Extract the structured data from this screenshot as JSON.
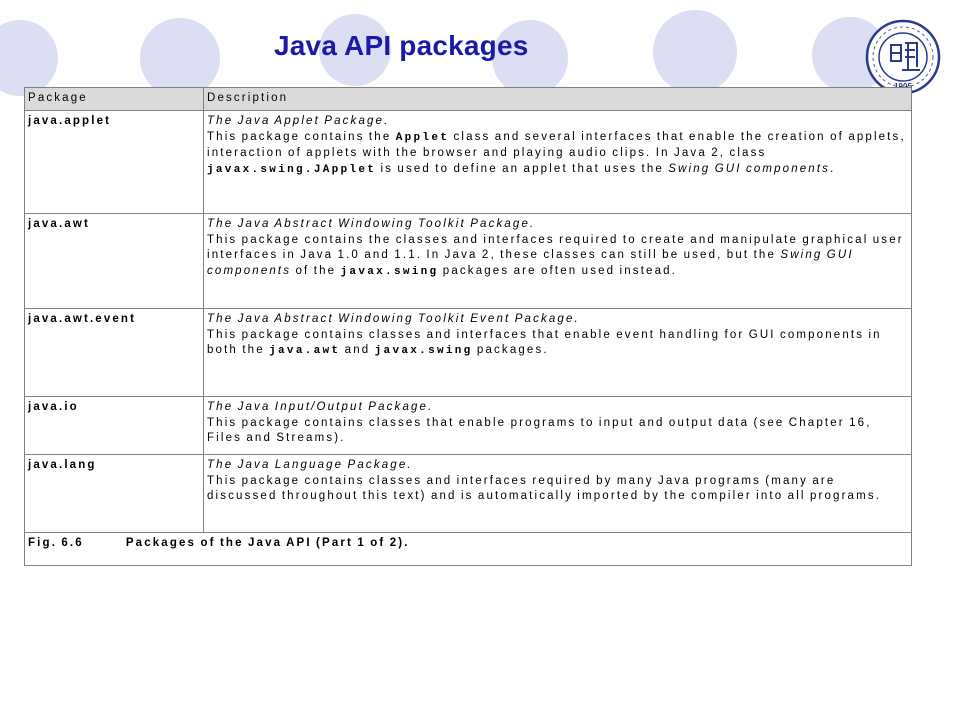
{
  "slide": {
    "title": "Java API packages",
    "logo_text": "1905"
  },
  "table": {
    "headers": [
      "Package",
      "Description"
    ],
    "rows": [
      {
        "package": "java.applet",
        "lead": "The Java Applet Package.",
        "t1": "This package contains the ",
        "c1": "Applet",
        "t2": " class and several interfaces that enable the creation of applets, interaction of applets with the browser and playing audio clips. In Java 2, class ",
        "c2": "javax.swing.JApplet",
        "t3": " is used to define an applet that uses the ",
        "i1": "Swing GUI components",
        "t4": "."
      },
      {
        "package": "java.awt",
        "lead": "The Java Abstract Windowing Toolkit Package.",
        "t1": "This package contains the classes and interfaces required to create and manipulate graphical user interfaces in Java 1.0 and 1.1. In Java 2, these classes can still be used, but the ",
        "i1": "Swing GUI components",
        "t2": " of the ",
        "c1": "javax.swing",
        "t3": " packages are often used instead."
      },
      {
        "package": "java.awt.event",
        "lead": "The Java Abstract Windowing Toolkit Event Package.",
        "t1": "This package contains classes and interfaces that enable event handling for GUI components in both the ",
        "c1": "java.awt",
        "t2": " and ",
        "c2": "javax.swing",
        "t3": " packages."
      },
      {
        "package": "java.io",
        "lead": "The Java Input/Output Package.",
        "t1": "This package contains classes that enable programs to input and output data (see Chapter 16, Files and Streams)."
      },
      {
        "package": "java.lang",
        "lead": "The Java Language Package.",
        "t1": "This package contains classes and interfaces required by many Java programs (many are discussed throughout this text) and is automatically imported by the compiler into all programs."
      }
    ],
    "caption_label": "Fig. 6.6",
    "caption_text": "Packages of the Java API (Part 1 of 2)."
  },
  "colors": {
    "title": "#1a1aa8",
    "bubble": "#d9dbf2",
    "logo": "#2a3a8c",
    "header_bg": "#dadada"
  }
}
